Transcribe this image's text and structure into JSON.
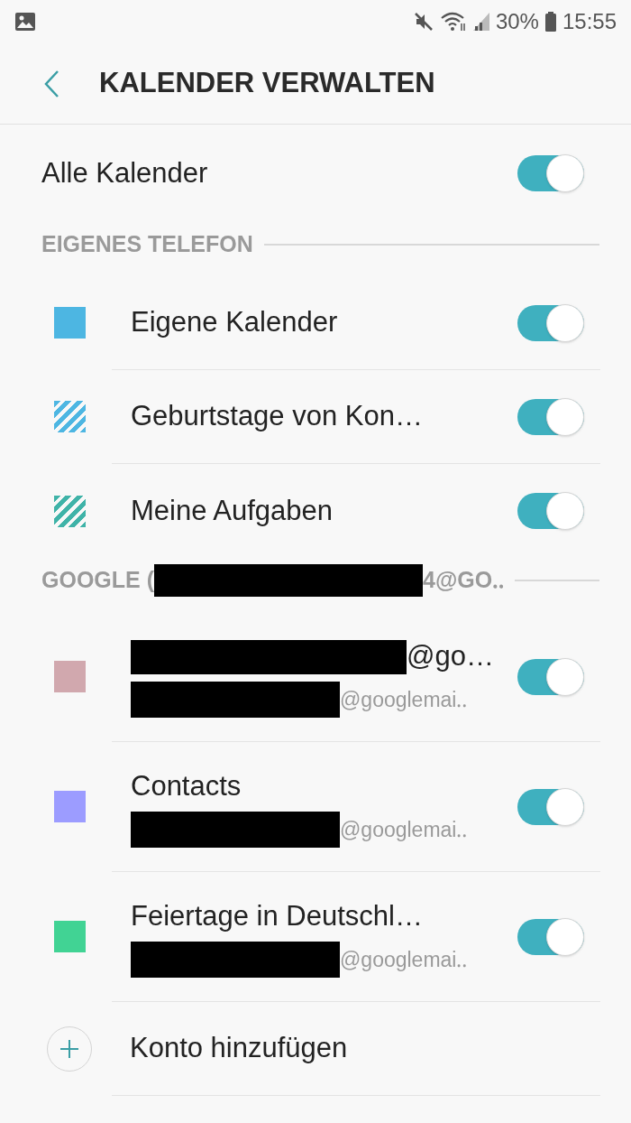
{
  "status_bar": {
    "battery": "30%",
    "time": "15:55"
  },
  "header": {
    "title": "KALENDER VERWALTEN"
  },
  "all_calendars": {
    "label": "Alle Kalender",
    "on": true
  },
  "sections": [
    {
      "title": "EIGENES TELEFON",
      "title_redacted": false,
      "calendars": [
        {
          "name": "Eigene Kalender",
          "name_redacted": false,
          "color": "#4db6e2",
          "kind": "solid",
          "on": true
        },
        {
          "name": "Geburtstage von Kon…",
          "name_redacted": false,
          "color": "#4db6e2",
          "kind": "striped",
          "on": true
        },
        {
          "name": "Meine Aufgaben",
          "name_redacted": false,
          "color": "#3fb3a8",
          "kind": "striped",
          "on": true
        }
      ]
    },
    {
      "title": "GOOGLE (",
      "title_redacted": true,
      "title_suffix": "4@GO‥",
      "calendars": [
        {
          "name": "@go…",
          "name_redacted": true,
          "account": "@googlemai‥",
          "color": "#d1a8ae",
          "kind": "solid",
          "on": true
        },
        {
          "name": "Contacts",
          "name_redacted": false,
          "account": "@googlemai‥",
          "color": "#9c9cff",
          "kind": "solid",
          "on": true
        },
        {
          "name": "Feiertage in Deutschl…",
          "name_redacted": false,
          "account": "@googlemai‥",
          "color": "#41d394",
          "kind": "solid",
          "on": true
        }
      ]
    }
  ],
  "add_account": {
    "label": "Konto hinzufügen"
  }
}
